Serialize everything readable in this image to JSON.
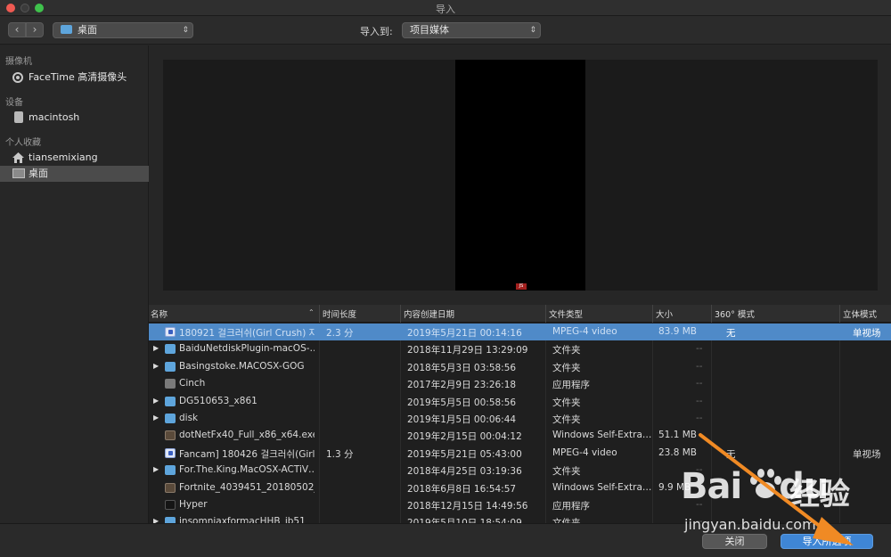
{
  "window": {
    "title": "导入"
  },
  "toolbar": {
    "location": "桌面",
    "import_to_label": "导入到:",
    "destination": "项目媒体"
  },
  "sidebar": {
    "sections": [
      {
        "header": "摄像机",
        "items": [
          {
            "label": "FaceTime 高清摄像头",
            "icon": "camera-icon"
          }
        ]
      },
      {
        "header": "设备",
        "items": [
          {
            "label": "macintosh",
            "icon": "disk-icon"
          }
        ]
      },
      {
        "header": "个人收藏",
        "items": [
          {
            "label": "tiansemixiang",
            "icon": "home-icon"
          },
          {
            "label": "桌面",
            "icon": "desktop-icon",
            "selected": true
          }
        ]
      }
    ]
  },
  "preview": {
    "marker_text": "JS"
  },
  "filelist": {
    "columns": [
      "名称",
      "时间长度",
      "内容创建日期",
      "文件类型",
      "大小",
      "360° 模式",
      "立体模式"
    ],
    "rows": [
      {
        "name": "180921 걸크러쉬(Girl Crush) 자…",
        "duration": "2.3 分",
        "date": "2019年5月21日 00:14:16",
        "type": "MPEG-4 video",
        "size": "83.9 MB",
        "mode360": "无",
        "stereo": "单视场",
        "icon": "video-icon",
        "disclosure": false,
        "selected": true
      },
      {
        "name": "BaiduNetdiskPlugin-macOS-…",
        "duration": "",
        "date": "2018年11月29日 13:29:09",
        "type": "文件夹",
        "size": "--",
        "mode360": "",
        "stereo": "",
        "icon": "folder-icon",
        "disclosure": true
      },
      {
        "name": "Basingstoke.MACOSX-GOG",
        "duration": "",
        "date": "2018年5月3日 03:58:56",
        "type": "文件夹",
        "size": "--",
        "mode360": "",
        "stereo": "",
        "icon": "folder-icon",
        "disclosure": true
      },
      {
        "name": "Cinch",
        "duration": "",
        "date": "2017年2月9日 23:26:18",
        "type": "应用程序",
        "size": "--",
        "mode360": "",
        "stereo": "",
        "icon": "app-icon",
        "disclosure": false
      },
      {
        "name": "DG510653_x861",
        "duration": "",
        "date": "2019年5月5日 00:58:56",
        "type": "文件夹",
        "size": "--",
        "mode360": "",
        "stereo": "",
        "icon": "folder-icon",
        "disclosure": true
      },
      {
        "name": "disk",
        "duration": "",
        "date": "2019年1月5日 00:06:44",
        "type": "文件夹",
        "size": "--",
        "mode360": "",
        "stereo": "",
        "icon": "folder-icon",
        "disclosure": true
      },
      {
        "name": "dotNetFx40_Full_x86_x64.exe",
        "duration": "",
        "date": "2019年2月15日 00:04:12",
        "type": "Windows Self-Extra…",
        "size": "51.1 MB",
        "mode360": "",
        "stereo": "",
        "icon": "exe-icon",
        "disclosure": false
      },
      {
        "name": "Fancam] 180426 걸크러쉬(Girl…",
        "duration": "1.3 分",
        "date": "2019年5月21日 05:43:00",
        "type": "MPEG-4 video",
        "size": "23.8 MB",
        "mode360": "无",
        "stereo": "单视场",
        "icon": "video-icon",
        "disclosure": false
      },
      {
        "name": "For.The.King.MacOSX-ACTiV…",
        "duration": "",
        "date": "2018年4月25日 03:19:36",
        "type": "文件夹",
        "size": "--",
        "mode360": "",
        "stereo": "",
        "icon": "folder-icon",
        "disclosure": true
      },
      {
        "name": "Fortnite_4039451_20180502_…",
        "duration": "",
        "date": "2018年6月8日 16:54:57",
        "type": "Windows Self-Extra…",
        "size": "9.9 MB",
        "mode360": "",
        "stereo": "",
        "icon": "exe-icon",
        "disclosure": false
      },
      {
        "name": "Hyper",
        "duration": "",
        "date": "2018年12月15日 14:49:56",
        "type": "应用程序",
        "size": "--",
        "mode360": "",
        "stereo": "",
        "icon": "exec-icon",
        "disclosure": false
      },
      {
        "name": "insomniaxformacHHB_ib51",
        "duration": "",
        "date": "2019年5月10日 18:54:09",
        "type": "文件夹",
        "size": "--",
        "mode360": "",
        "stereo": "",
        "icon": "folder-icon",
        "disclosure": true
      }
    ]
  },
  "buttons": {
    "close": "关闭",
    "import": "导入所选项"
  },
  "watermark": {
    "brand": "Bai",
    "brand_suffix": "du",
    "jingyan": "经验",
    "url": "jingyan.baidu.com"
  },
  "colors": {
    "selection": "#4f8ac8",
    "primary_button": "#3f86d5",
    "annotation_arrow": "#f08a24"
  }
}
